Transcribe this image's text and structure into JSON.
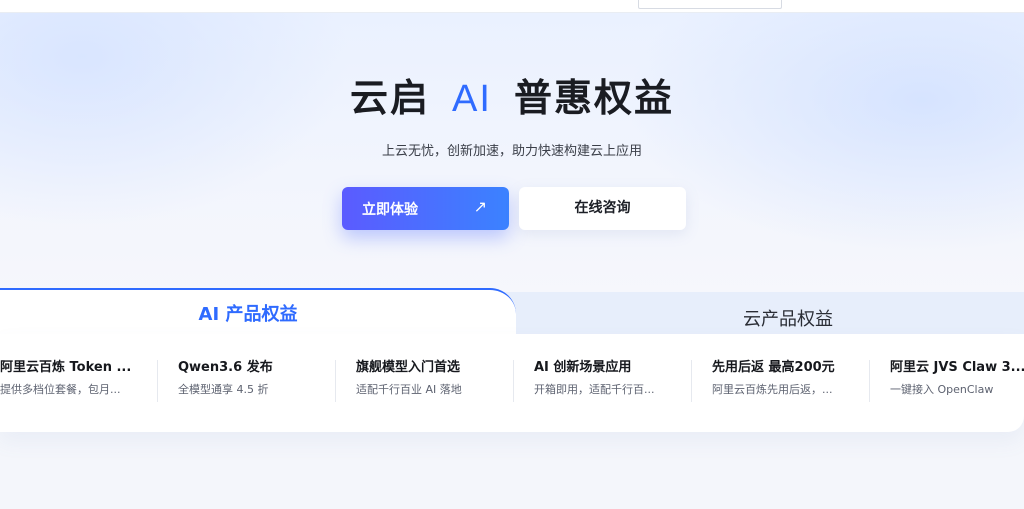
{
  "hero": {
    "title_part1": "云启",
    "title_ai": "AI",
    "title_part2": "普惠权益",
    "subtitle": "上云无忧，创新加速，助力快速构建云上应用",
    "primary_button": "立即体验",
    "primary_button_icon": "arrow-up-right-icon",
    "secondary_button": "在线咨询"
  },
  "tabs": [
    {
      "label": "AI 产品权益",
      "active": true
    },
    {
      "label": "云产品权益",
      "active": false
    }
  ],
  "cards": [
    {
      "title": "阿里云百炼 Token ...",
      "subtitle": "提供多档位套餐，包月..."
    },
    {
      "title": "Qwen3.6 发布",
      "subtitle": "全模型通享 4.5 折"
    },
    {
      "title": "旗舰模型入门首选",
      "subtitle": "适配千行百业 AI 落地"
    },
    {
      "title": "AI 创新场景应用",
      "subtitle": "开箱即用，适配千行百..."
    },
    {
      "title": "先用后返 最高200元",
      "subtitle": "阿里云百炼先用后返，..."
    },
    {
      "title": "阿里云 JVS Claw 3...",
      "subtitle": "一键接入 OpenClaw"
    }
  ],
  "colors": {
    "accent": "#2f6bff",
    "primary_gradient_start": "#5b5bff",
    "primary_gradient_end": "#3b82ff"
  }
}
